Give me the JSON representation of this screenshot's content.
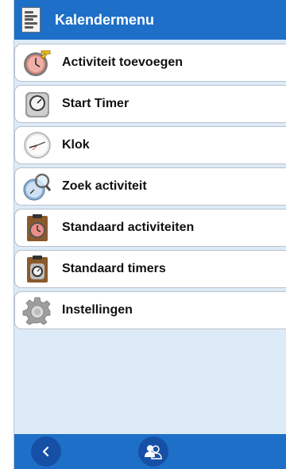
{
  "header": {
    "title": "Kalendermenu",
    "icon": "calendar-list-icon"
  },
  "menu": {
    "items": [
      {
        "label": "Activiteit toevoegen",
        "icon": "clock-add-icon"
      },
      {
        "label": "Start Timer",
        "icon": "stopwatch-icon"
      },
      {
        "label": "Klok",
        "icon": "clock-icon"
      },
      {
        "label": "Zoek activiteit",
        "icon": "clock-search-icon"
      },
      {
        "label": "Standaard activiteiten",
        "icon": "clipboard-clock-icon"
      },
      {
        "label": "Standaard timers",
        "icon": "clipboard-timer-icon"
      },
      {
        "label": "Instellingen",
        "icon": "gear-icon"
      }
    ]
  },
  "bottombar": {
    "back_icon": "chevron-left-icon",
    "user_icon": "users-icon"
  },
  "colors": {
    "accent": "#1e6fc7",
    "background": "#ddeaf7"
  }
}
